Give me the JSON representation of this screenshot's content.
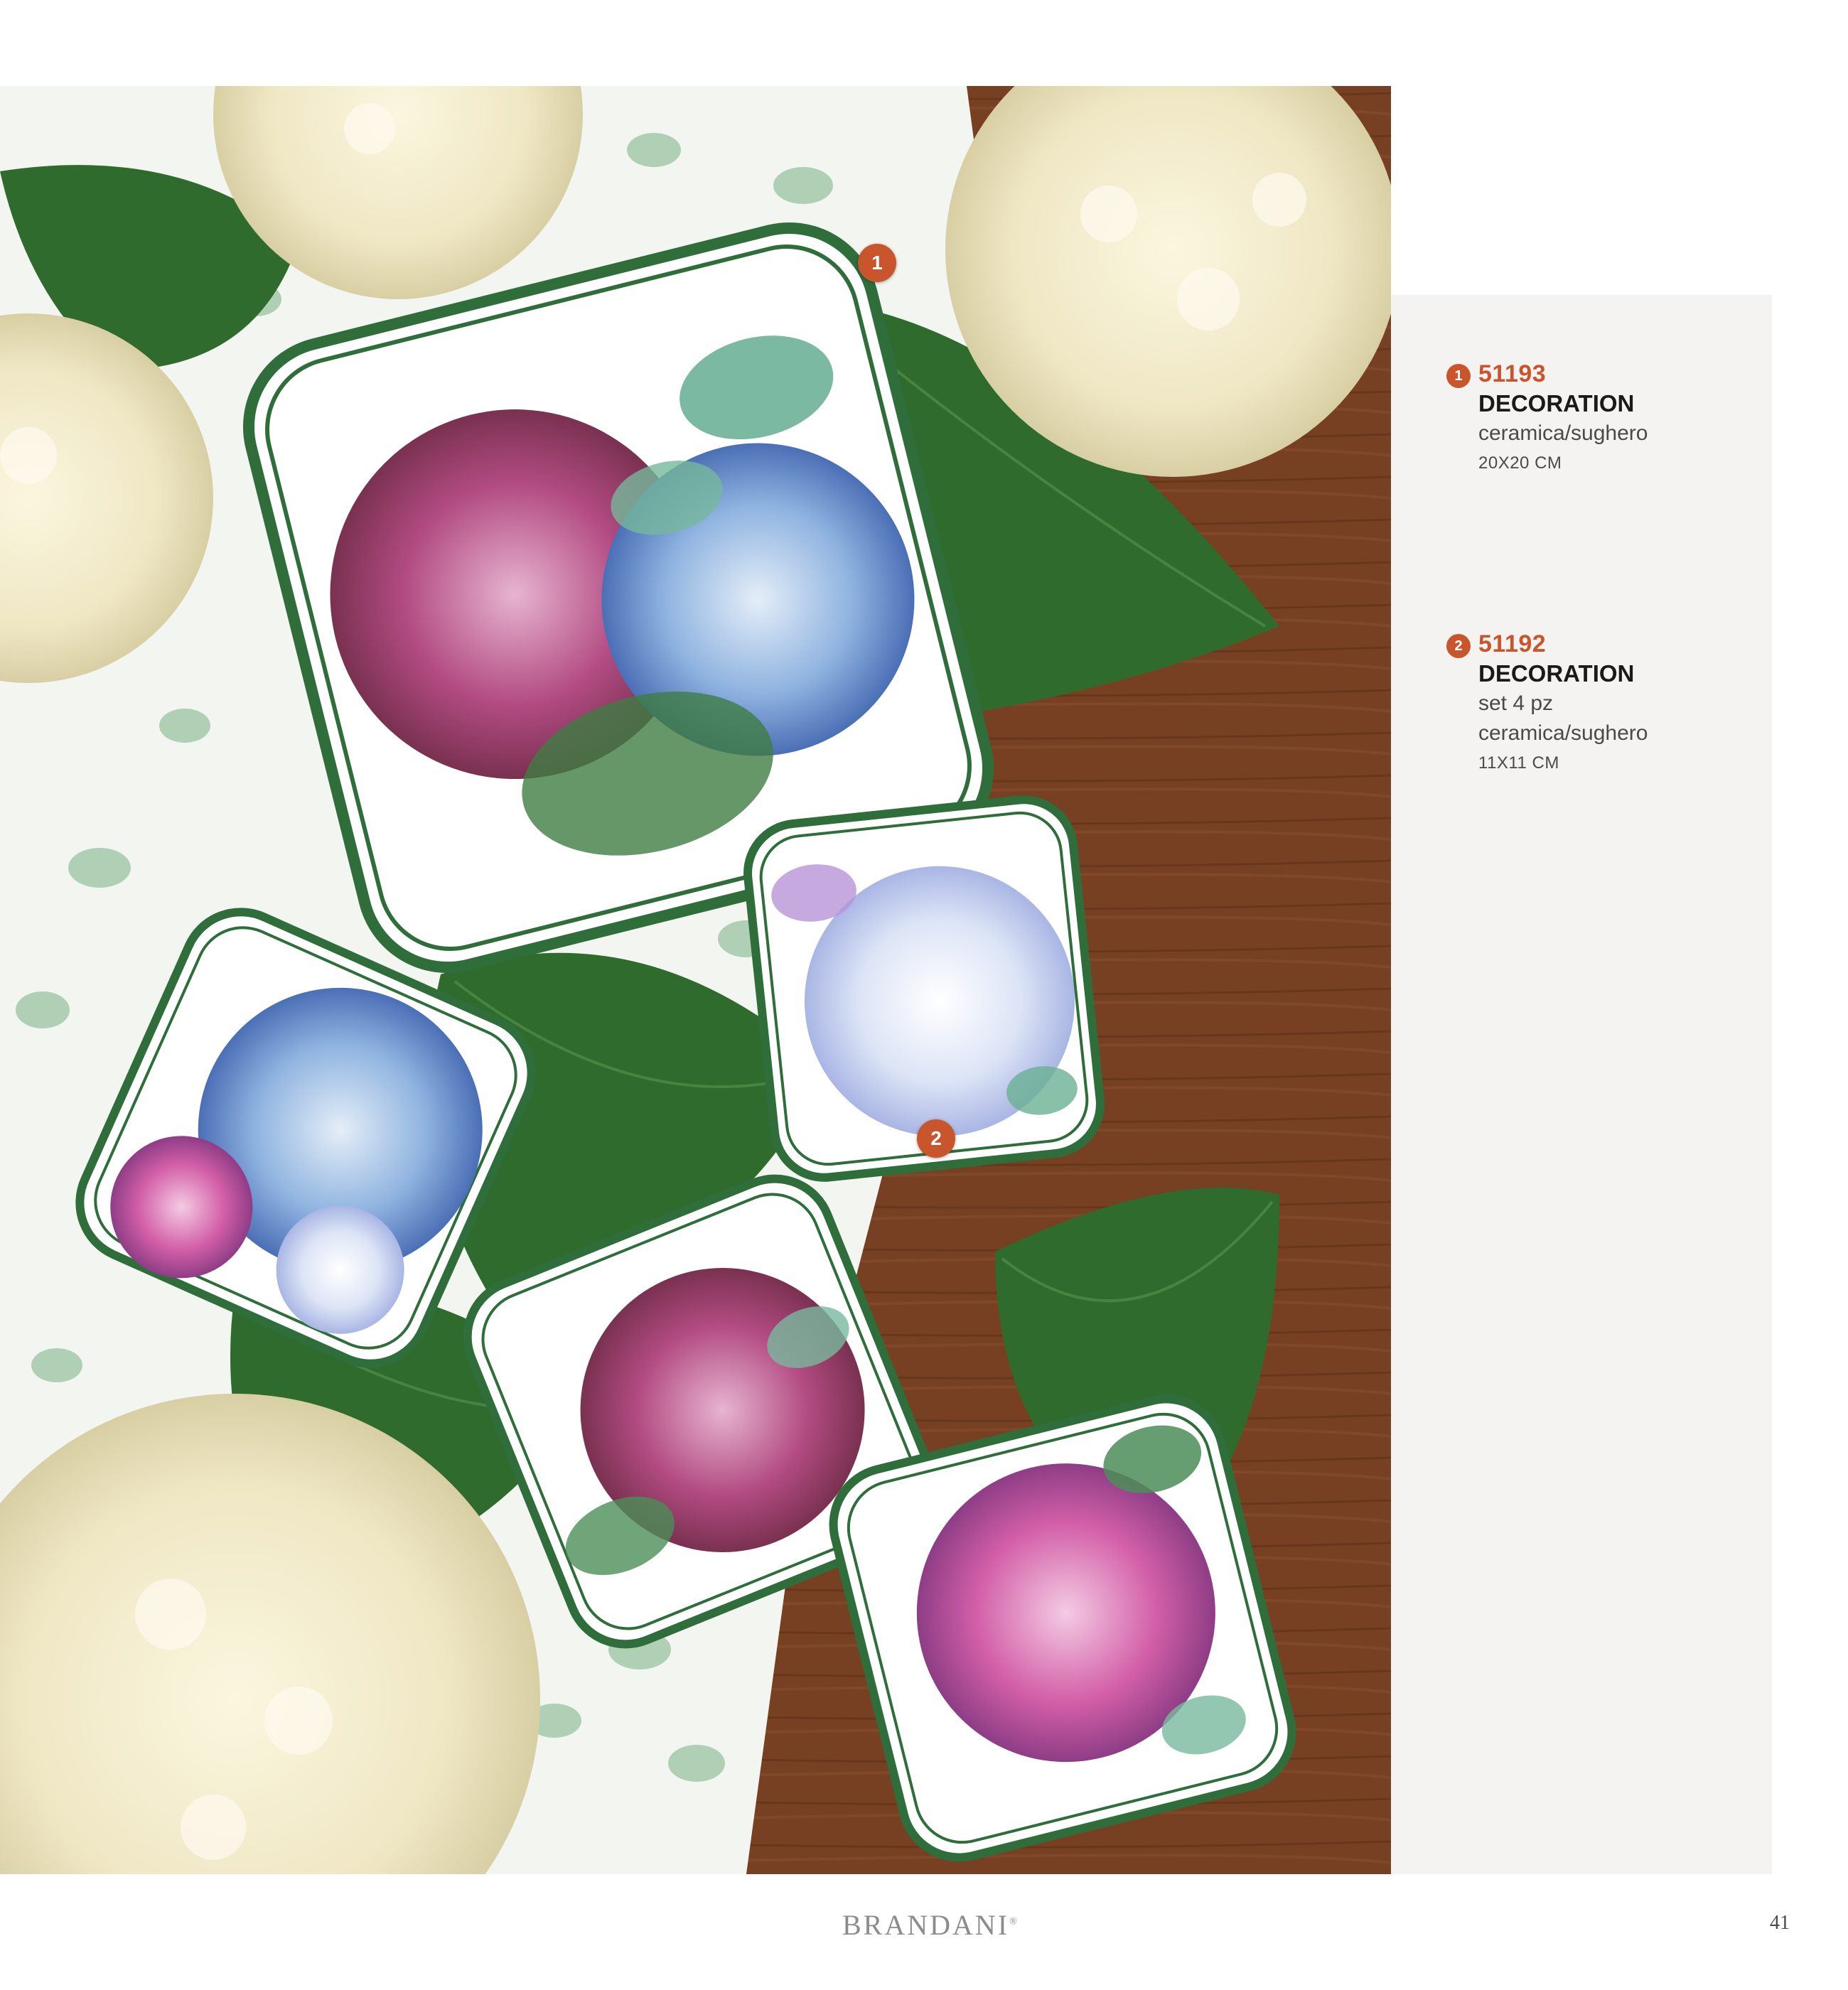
{
  "products": [
    {
      "number": "1",
      "code": "51193",
      "name": "DECORATION",
      "details": [
        "ceramica/sughero"
      ],
      "size": "20X20 CM"
    },
    {
      "number": "2",
      "code": "51192",
      "name": "DECORATION",
      "details": [
        "set 4 pz",
        "ceramica/sughero"
      ],
      "size": "11X11 CM"
    }
  ],
  "photo_callouts": [
    "1",
    "2"
  ],
  "footer": {
    "brand": "BRANDANI",
    "page_number": "41"
  },
  "colors": {
    "accent": "#c9552d",
    "panel_bg": "#f4f3f1",
    "rim_green": "#2f6e3a"
  }
}
